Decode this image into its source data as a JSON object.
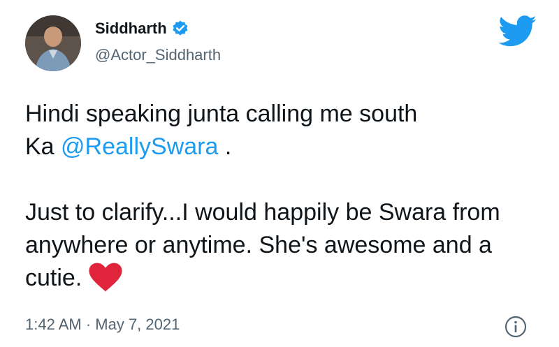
{
  "author": {
    "display_name": "Siddharth",
    "handle": "@Actor_Siddharth",
    "verified": true
  },
  "tweet": {
    "line1": "Hindi speaking junta calling me south",
    "line2_prefix": "Ka ",
    "mention": "@ReallySwara",
    "line2_suffix": " .",
    "para2": "Just to clarify...I would happily be Swara from anywhere or anytime. She's awesome and a cutie.",
    "emoji": "red-heart"
  },
  "meta": {
    "timestamp": "1:42 AM · May 7, 2021"
  },
  "icons": {
    "logo": "twitter-bird-icon",
    "verified": "verified-badge-icon",
    "info": "info-icon"
  },
  "colors": {
    "brand": "#1d9bf0",
    "text": "#0f1419",
    "secondary": "#536471",
    "heart": "#e0243b"
  }
}
